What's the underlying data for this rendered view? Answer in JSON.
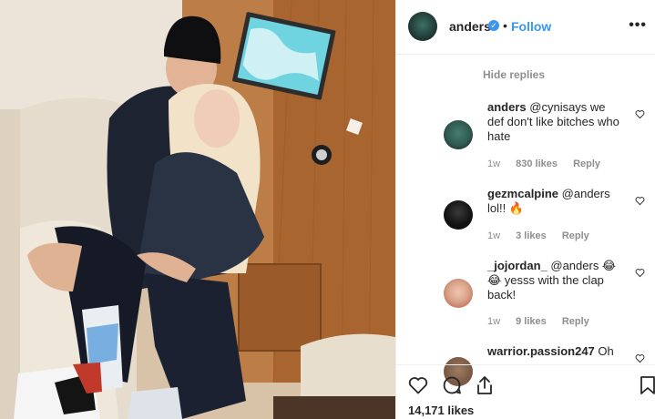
{
  "header": {
    "username": "anders",
    "verified_mark": "✓",
    "separator": "•",
    "follow_label": "Follow",
    "more_label": "•••"
  },
  "hide_replies_label": "Hide replies",
  "comments": [
    {
      "user": "anders",
      "text": "@cynisays we def don't like bitches who hate",
      "age": "1w",
      "likes": "830 likes",
      "reply": "Reply",
      "avatar_color": "#2f5a50"
    },
    {
      "user": "gezmcalpine",
      "text": "@anders lol!! 🔥",
      "age": "1w",
      "likes": "3 likes",
      "reply": "Reply",
      "avatar_color": "#111111"
    },
    {
      "user": "_jojordan_",
      "text": "@anders 😂 😂 yesss with the clap back!",
      "age": "1w",
      "likes": "9 likes",
      "reply": "Reply",
      "avatar_color": "#d9a58c"
    },
    {
      "user": "warrior.passion247",
      "text": "Oh",
      "avatar_color": "#7a5a45"
    }
  ],
  "footer": {
    "likes_total": "14,171 likes"
  },
  "icons": {
    "like": "heart-icon",
    "comment": "comment-bubble-icon",
    "share": "share-icon",
    "save": "bookmark-icon"
  },
  "colors": {
    "accent": "#3897f0",
    "muted": "#8e8e8e",
    "text": "#262626"
  }
}
